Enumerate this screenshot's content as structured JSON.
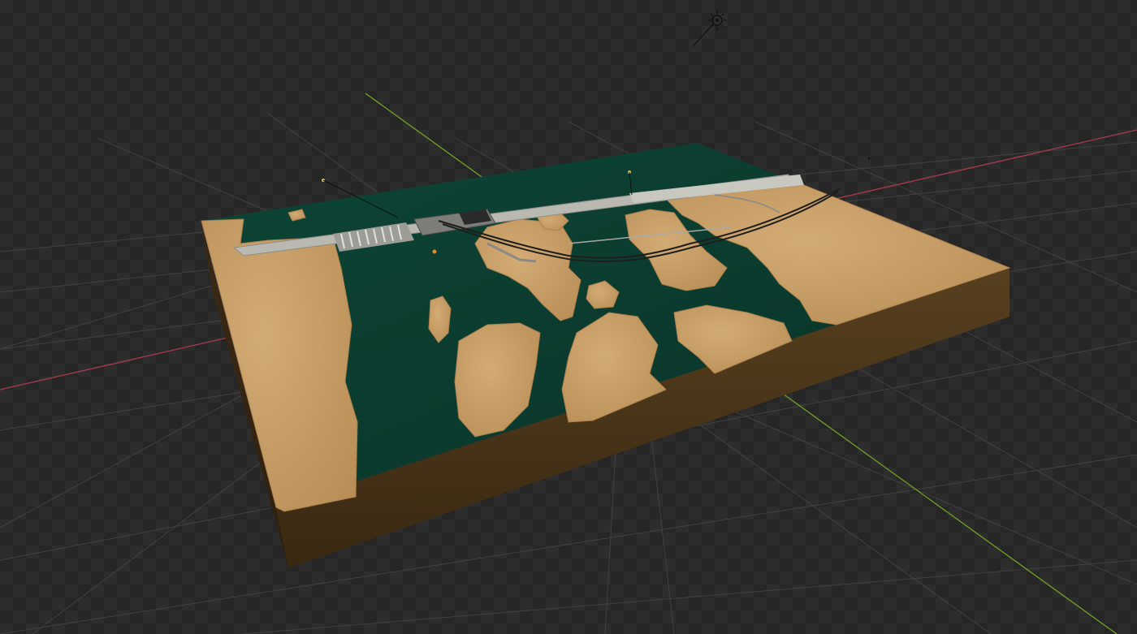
{
  "viewport": {
    "mode": "3d-viewport-render-preview",
    "background": "transparent-checkerboard",
    "colors": {
      "checker_dark": "#262626",
      "checker_light": "#2d2d2d",
      "grid_line": "#4a4a4a",
      "x_axis": "#a33a4c",
      "y_axis": "#6c9a24"
    }
  },
  "scene": {
    "objects": [
      {
        "name": "terrain-block",
        "icon": "terrain-icon"
      },
      {
        "name": "river-water",
        "icon": "water-icon"
      },
      {
        "name": "dam-barrage",
        "icon": "dam-icon"
      },
      {
        "name": "bridge-road",
        "icon": "bridge-icon"
      },
      {
        "name": "sun-lamp",
        "icon": "sun-icon"
      },
      {
        "name": "point-lights",
        "icon": "light-icon"
      }
    ],
    "colors": {
      "water": "#0b3a2d",
      "water_edge": "#0f4a38",
      "sand": "#c9a06a",
      "sand_shadow": "#a97f4c",
      "soil_side": "#4a3418",
      "soil_side_dark": "#3a2812",
      "dam": "#b9b9b2",
      "cable": "#1e1e1e"
    }
  }
}
